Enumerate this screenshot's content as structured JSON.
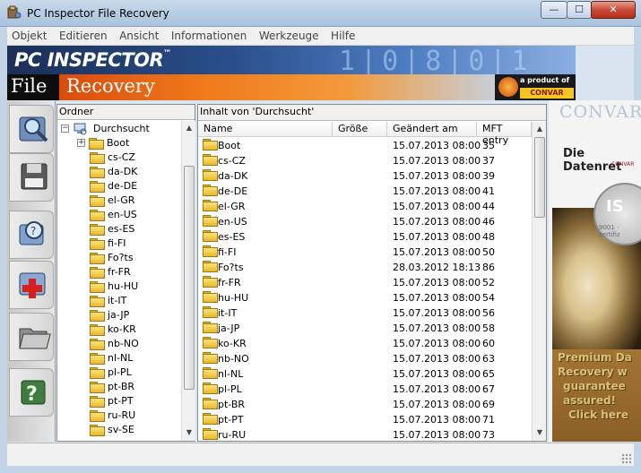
{
  "window": {
    "title": "PC Inspector File Recovery",
    "minimize": "—",
    "maximize": "☐",
    "close": "✕"
  },
  "menu": [
    "Objekt",
    "Editieren",
    "Ansicht",
    "Informationen",
    "Werkzeuge",
    "Hilfe"
  ],
  "banner": {
    "logo_line1": "PC INSPECTOR",
    "trademark": "™",
    "logo_file": "File",
    "logo_recovery": "Recovery",
    "product_of": "a product of",
    "convar": "CONVAR"
  },
  "toolbar_icons": [
    "search-disk-icon",
    "save-disk-icon",
    "search-lost-icon",
    "add-drive-icon",
    "folder-open-icon",
    "help-icon"
  ],
  "tree": {
    "header": "Ordner",
    "root_label": "Durchsucht",
    "items": [
      "Boot",
      "cs-CZ",
      "da-DK",
      "de-DE",
      "el-GR",
      "en-US",
      "es-ES",
      "fi-FI",
      "Fo?ts",
      "fr-FR",
      "hu-HU",
      "it-IT",
      "ja-JP",
      "ko-KR",
      "nb-NO",
      "nl-NL",
      "pl-PL",
      "pt-BR",
      "pt-PT",
      "ru-RU",
      "sv-SE"
    ]
  },
  "list": {
    "caption": "Inhalt von 'Durchsucht'",
    "columns": {
      "name": "Name",
      "size": "Größe",
      "changed": "Geändert am",
      "mft": "MFT entry"
    },
    "rows": [
      {
        "name": "Boot",
        "size": "",
        "changed": "15.07.2013 08:00",
        "mft": "35"
      },
      {
        "name": "cs-CZ",
        "size": "",
        "changed": "15.07.2013 08:00",
        "mft": "37"
      },
      {
        "name": "da-DK",
        "size": "",
        "changed": "15.07.2013 08:00",
        "mft": "39"
      },
      {
        "name": "de-DE",
        "size": "",
        "changed": "15.07.2013 08:00",
        "mft": "41"
      },
      {
        "name": "el-GR",
        "size": "",
        "changed": "15.07.2013 08:00",
        "mft": "44"
      },
      {
        "name": "en-US",
        "size": "",
        "changed": "15.07.2013 08:00",
        "mft": "46"
      },
      {
        "name": "es-ES",
        "size": "",
        "changed": "15.07.2013 08:00",
        "mft": "48"
      },
      {
        "name": "fi-FI",
        "size": "",
        "changed": "15.07.2013 08:00",
        "mft": "50"
      },
      {
        "name": "Fo?ts",
        "size": "",
        "changed": "28.03.2012 18:13",
        "mft": "86"
      },
      {
        "name": "fr-FR",
        "size": "",
        "changed": "15.07.2013 08:00",
        "mft": "52"
      },
      {
        "name": "hu-HU",
        "size": "",
        "changed": "15.07.2013 08:00",
        "mft": "54"
      },
      {
        "name": "it-IT",
        "size": "",
        "changed": "15.07.2013 08:00",
        "mft": "56"
      },
      {
        "name": "ja-JP",
        "size": "",
        "changed": "15.07.2013 08:00",
        "mft": "58"
      },
      {
        "name": "ko-KR",
        "size": "",
        "changed": "15.07.2013 08:00",
        "mft": "60"
      },
      {
        "name": "nb-NO",
        "size": "",
        "changed": "15.07.2013 08:00",
        "mft": "63"
      },
      {
        "name": "nl-NL",
        "size": "",
        "changed": "15.07.2013 08:00",
        "mft": "65"
      },
      {
        "name": "pl-PL",
        "size": "",
        "changed": "15.07.2013 08:00",
        "mft": "67"
      },
      {
        "name": "pt-BR",
        "size": "",
        "changed": "15.07.2013 08:00",
        "mft": "69"
      },
      {
        "name": "pt-PT",
        "size": "",
        "changed": "15.07.2013 08:00",
        "mft": "71"
      },
      {
        "name": "ru-RU",
        "size": "",
        "changed": "15.07.2013 08:00",
        "mft": "73"
      }
    ]
  },
  "ad": {
    "convar": "CONVAR",
    "datenret": "Die Datenret",
    "sub": "CONVAR",
    "iso": "IS",
    "iso_sub": "9001 · zertifiz",
    "lines": [
      "Premium Da",
      "Recovery w",
      "guarantee",
      "assured!",
      "Click here"
    ]
  },
  "colors": {
    "accent": "#d94c0d",
    "folder": "#f0c84a",
    "close_button": "#c74a36"
  }
}
